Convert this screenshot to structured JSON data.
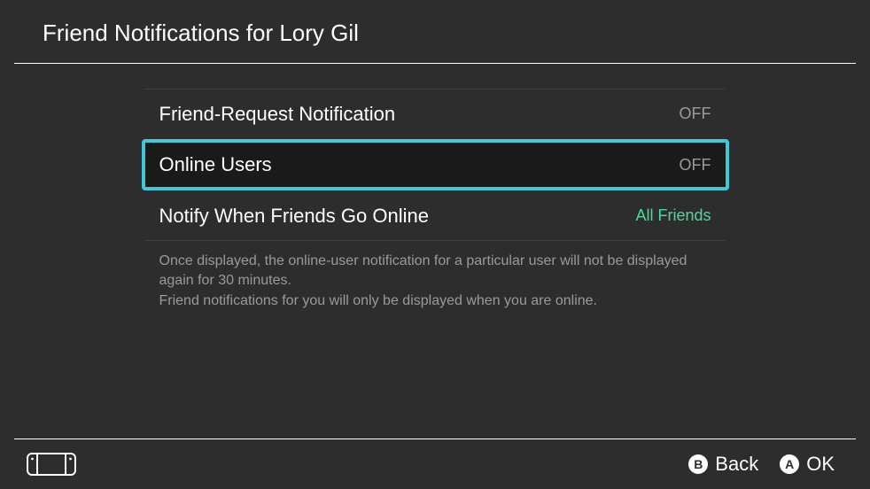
{
  "header": {
    "title": "Friend Notifications for Lory Gil"
  },
  "settings": {
    "friend_request": {
      "label": "Friend-Request Notification",
      "value": "OFF"
    },
    "online_users": {
      "label": "Online Users",
      "value": "OFF"
    },
    "notify_online": {
      "label": "Notify When Friends Go Online",
      "value": "All Friends"
    }
  },
  "help_text": {
    "line1": "Once displayed, the online-user notification for a particular user will not be displayed again for 30 minutes.",
    "line2": "Friend notifications for you will only be displayed when you are online."
  },
  "footer": {
    "back": {
      "button": "B",
      "label": "Back"
    },
    "ok": {
      "button": "A",
      "label": "OK"
    }
  }
}
